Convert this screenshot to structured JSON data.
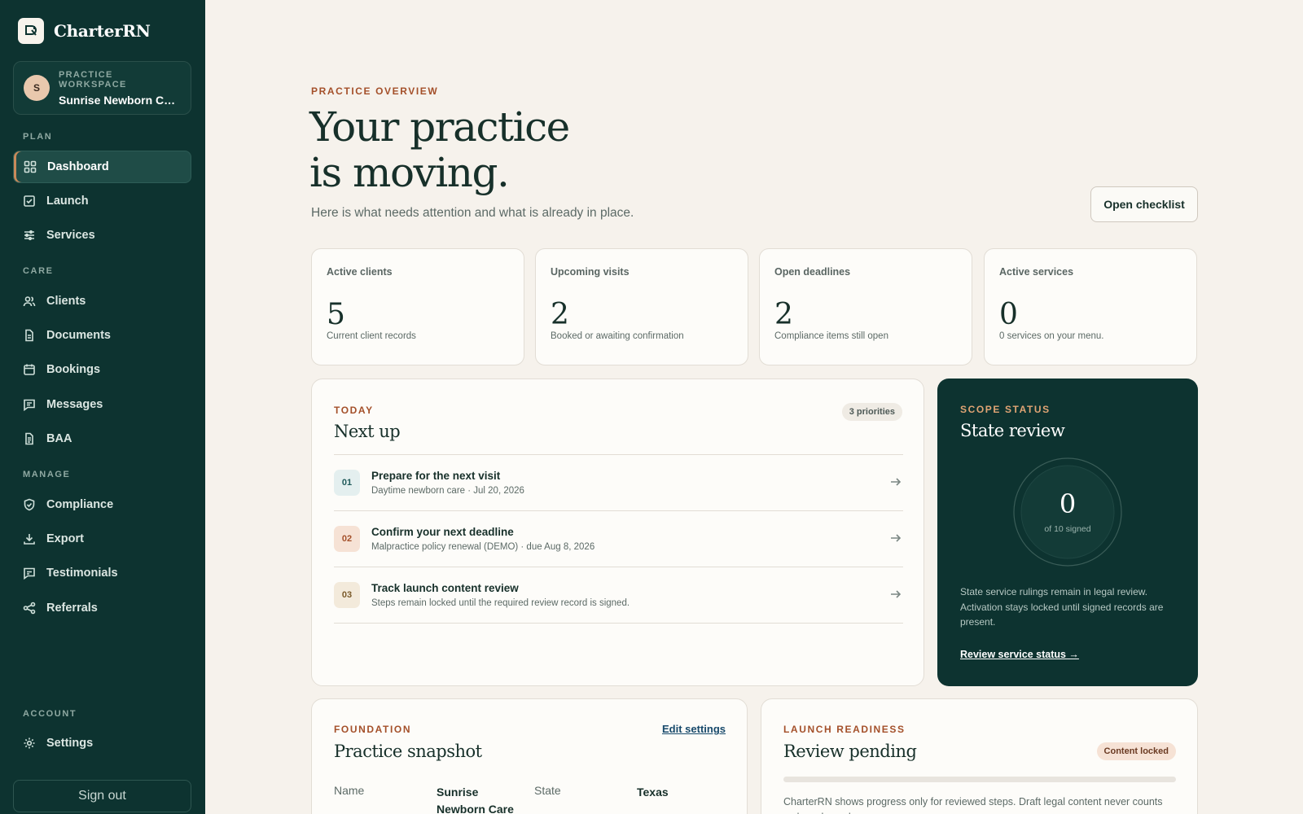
{
  "brand": {
    "name": "CharterRN"
  },
  "workspace": {
    "kicker": "PRACTICE WORKSPACE",
    "name": "Sunrise Newborn Care",
    "avatar": "S"
  },
  "nav": {
    "sections": {
      "plan": "PLAN",
      "care": "CARE",
      "manage": "MANAGE",
      "account": "ACCOUNT"
    },
    "items": [
      {
        "label": "Dashboard",
        "icon": "grid-icon",
        "active": true
      },
      {
        "label": "Launch",
        "icon": "checkbox-icon"
      },
      {
        "label": "Services",
        "icon": "sliders-icon"
      },
      {
        "label": "Clients",
        "icon": "users-icon"
      },
      {
        "label": "Documents",
        "icon": "document-icon"
      },
      {
        "label": "Bookings",
        "icon": "calendar-icon"
      },
      {
        "label": "Messages",
        "icon": "message-icon"
      },
      {
        "label": "BAA",
        "icon": "file-icon"
      },
      {
        "label": "Compliance",
        "icon": "shield-check-icon"
      },
      {
        "label": "Export",
        "icon": "download-icon"
      },
      {
        "label": "Testimonials",
        "icon": "quote-icon"
      },
      {
        "label": "Referrals",
        "icon": "share-icon"
      },
      {
        "label": "Settings",
        "icon": "gear-icon"
      }
    ],
    "signout": "Sign out"
  },
  "header": {
    "kicker": "PRACTICE OVERVIEW",
    "title_line1": "Your practice",
    "title_line2": "is moving.",
    "subtitle": "Here is what needs attention and what is already in place.",
    "checklist_button": "Open checklist"
  },
  "stats": [
    {
      "label": "Active clients",
      "value": "5",
      "desc": "Current client records"
    },
    {
      "label": "Upcoming visits",
      "value": "2",
      "desc": "Booked or awaiting confirmation"
    },
    {
      "label": "Open deadlines",
      "value": "2",
      "desc": "Compliance items still open"
    },
    {
      "label": "Active services",
      "value": "0",
      "desc": "0 services on your menu."
    }
  ],
  "next_up": {
    "kicker": "TODAY",
    "title": "Next up",
    "badge": "3 priorities",
    "tasks": [
      {
        "num": "01",
        "title": "Prepare for the next visit",
        "meta": "Daytime newborn care · Jul 20, 2026"
      },
      {
        "num": "02",
        "title": "Confirm your next deadline",
        "meta": "Malpractice policy renewal (DEMO) · due Aug 8, 2026"
      },
      {
        "num": "03",
        "title": "Track launch content review",
        "meta": "Steps remain locked until the required review record is signed."
      }
    ]
  },
  "scope": {
    "kicker": "SCOPE STATUS",
    "title": "State review",
    "signed": "0",
    "caption": "of 10 signed",
    "signed_fraction": 0,
    "text": "State service rulings remain in legal review. Activation stays locked until signed records are present.",
    "link": "Review service status →"
  },
  "snapshot": {
    "kicker": "FOUNDATION",
    "title": "Practice snapshot",
    "edit": "Edit settings",
    "name_label": "Name",
    "name_value": "Sunrise Newborn Care",
    "state_label": "State",
    "state_value": "Texas"
  },
  "readiness": {
    "kicker": "LAUNCH READINESS",
    "title": "Review pending",
    "badge": "Content locked",
    "progress": 0,
    "text": "CharterRN shows progress only for reviewed steps. Draft legal content never counts as launch-ready."
  },
  "colors": {
    "sidebar": "#0d3330",
    "accent": "#a4502a",
    "background": "#f6f2ec"
  }
}
